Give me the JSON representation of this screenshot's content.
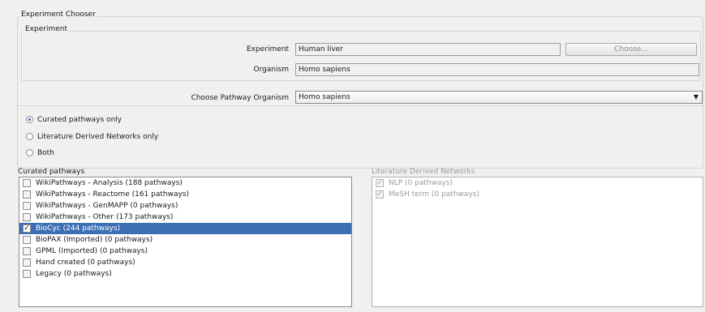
{
  "chooser": {
    "title": "Experiment Chooser",
    "experiment_group": "Experiment",
    "experiment_label": "Experiment",
    "experiment_value": "Human liver",
    "choose_button": "Choose...",
    "organism_label": "Organism",
    "organism_value": "Homo sapiens"
  },
  "pathway_organism": {
    "label": "Choose Pathway Organism",
    "selected": "Homo sapiens"
  },
  "mode_options": [
    {
      "label": "Curated pathways only",
      "selected": true
    },
    {
      "label": "Literature Derived Networks only",
      "selected": false
    },
    {
      "label": "Both",
      "selected": false
    }
  ],
  "curated": {
    "title": "Curated pathways",
    "items": [
      {
        "label": "WikiPathways - Analysis (188 pathways)",
        "checked": false
      },
      {
        "label": "WikiPathways - Reactome (161 pathways)",
        "checked": false
      },
      {
        "label": "WikiPathways - GenMAPP (0 pathways)",
        "checked": false
      },
      {
        "label": "WikiPathways - Other (173 pathways)",
        "checked": false
      },
      {
        "label": "BioCyc (244 pathways)",
        "checked": true
      },
      {
        "label": "BioPAX (Imported) (0 pathways)",
        "checked": false
      },
      {
        "label": "GPML (Imported) (0 pathways)",
        "checked": false
      },
      {
        "label": "Hand created (0 pathways)",
        "checked": false
      },
      {
        "label": "Legacy (0 pathways)",
        "checked": false
      }
    ]
  },
  "literature": {
    "title": "Literature Derived Networks",
    "items": [
      {
        "label": "NLP (0 pathways)",
        "checked": true
      },
      {
        "label": "MeSH term (0 pathways)",
        "checked": true
      }
    ]
  }
}
